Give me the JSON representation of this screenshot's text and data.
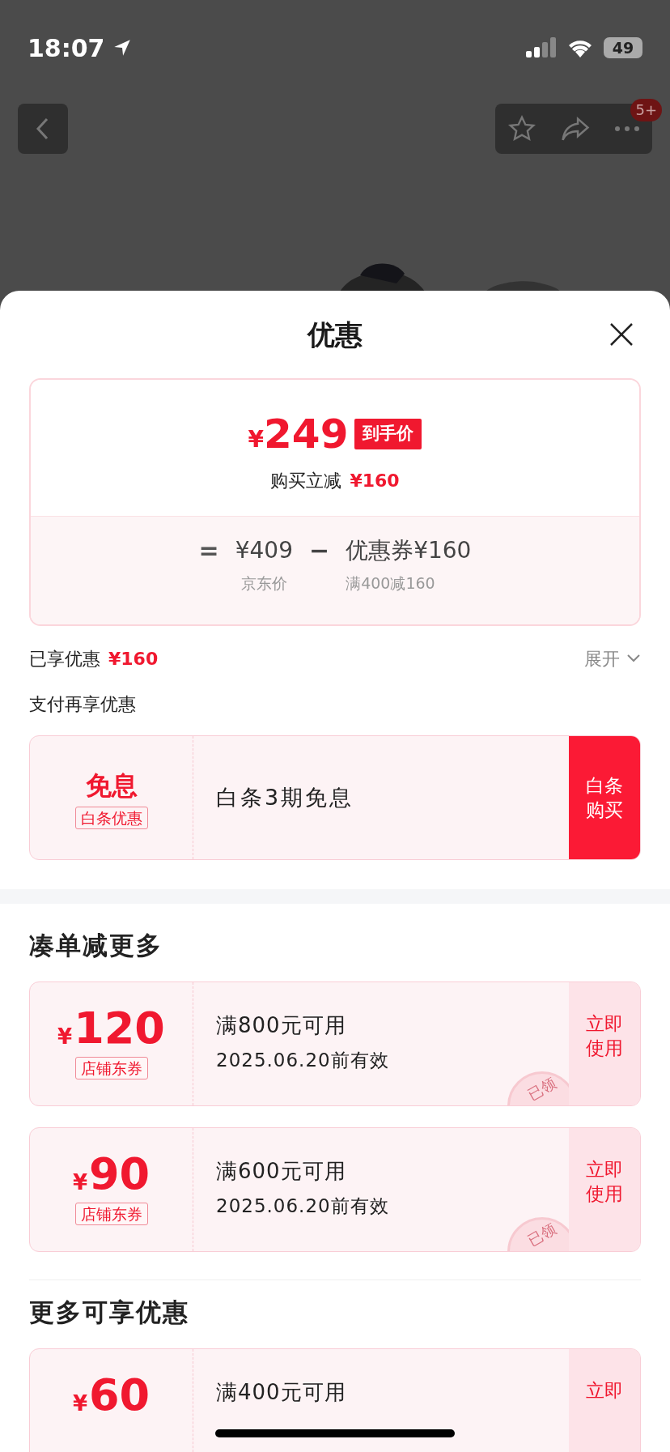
{
  "status_bar": {
    "time": "18:07",
    "battery": "49"
  },
  "nav": {
    "badge": "5+"
  },
  "sheet": {
    "title": "优惠"
  },
  "price_card": {
    "currency": "¥",
    "final_price": "249",
    "final_label": "到手价",
    "saving_label": "购买立减",
    "saving_amount": "¥160",
    "equals": "=",
    "jd_price": "¥409",
    "minus": "−",
    "coupon_label": "优惠券¥160",
    "jd_price_caption": "京东价",
    "coupon_caption": "满400减160"
  },
  "enjoyed": {
    "label": "已享优惠",
    "amount": "¥160",
    "toggle": "展开",
    "expanded": false
  },
  "pay_section": {
    "title": "支付再享优惠",
    "offer": {
      "headline": "免息",
      "tag": "白条优惠",
      "description": "白条3期免息",
      "action": "白条购买"
    }
  },
  "sections": [
    {
      "title": "凑单减更多",
      "coupons": [
        {
          "currency": "¥",
          "amount": "120",
          "tag": "店铺东券",
          "condition": "满800元可用",
          "validity": "2025.06.20前有效",
          "action": "立即使用",
          "claimed": true,
          "stamp": "已领"
        },
        {
          "currency": "¥",
          "amount": "90",
          "tag": "店铺东券",
          "condition": "满600元可用",
          "validity": "2025.06.20前有效",
          "action": "立即使用",
          "claimed": true,
          "stamp": "已领"
        }
      ]
    },
    {
      "title": "更多可享优惠",
      "coupons": [
        {
          "currency": "¥",
          "amount": "60",
          "condition": "满400元可用",
          "action": "立即",
          "claimed": false
        }
      ]
    }
  ]
}
